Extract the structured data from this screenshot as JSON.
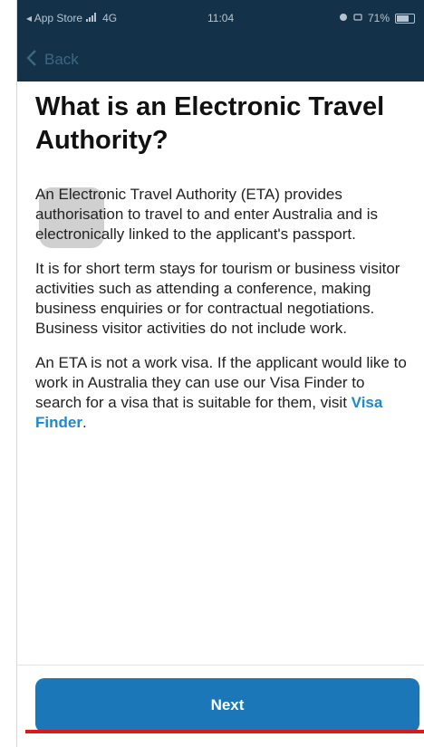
{
  "status_bar": {
    "carrier": "◂ App Store",
    "network": "4G",
    "time": "11:04",
    "battery": "71%"
  },
  "nav": {
    "back_label": "Back"
  },
  "page": {
    "title": "What is an Electronic Travel Authority?",
    "paragraph_1": "An Electronic Travel Authority (ETA) provides authorisation to travel to and enter Australia and is electronically linked to the applicant's passport.",
    "paragraph_2": "It is for short term stays for tourism or business visitor activities such as attending a conference, making business enquiries or for contractual negotiations. Business visitor activities do not include work.",
    "paragraph_3_text": "An ETA is not a work visa. If the applicant would like to work in Australia they can use our Visa Finder to search for a visa that is suitable for them, visit ",
    "paragraph_3_link": "Visa Finder",
    "paragraph_3_end": "."
  },
  "footer": {
    "next_label": "Next"
  },
  "colors": {
    "header_bg": "#13324a",
    "button_bg": "#1b77b8",
    "link": "#1b8ad1",
    "annotation_red": "#e0161b"
  }
}
